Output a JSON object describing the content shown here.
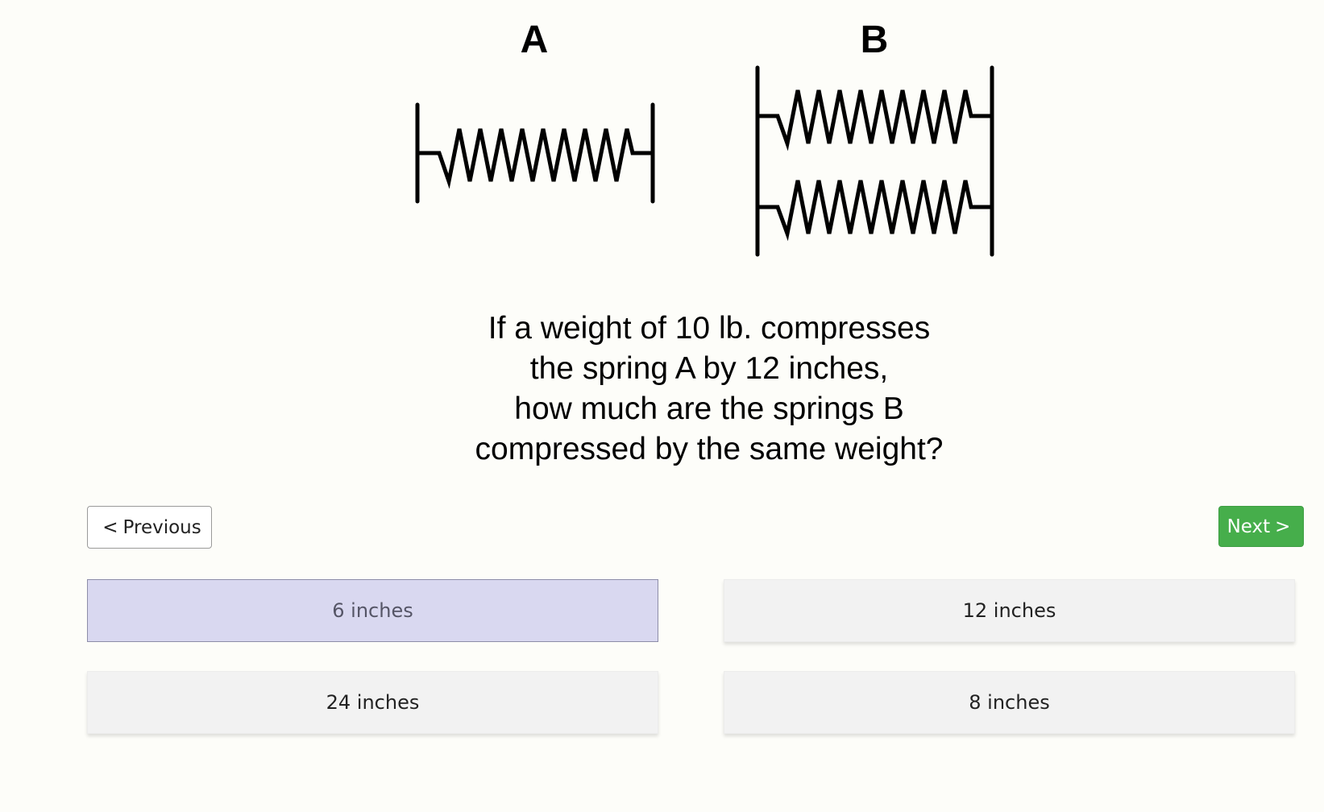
{
  "figure": {
    "label_a": "A",
    "label_b": "B",
    "question_lines": [
      "If a weight of 10 lb. compresses",
      "the spring A by 12 inches,",
      "how much are the springs B",
      "compressed by the same weight?"
    ]
  },
  "navigation": {
    "previous_label": "Previous",
    "next_label": "Next",
    "previous_chevron": "<",
    "next_chevron": ">",
    "next_color": "#46ae4b"
  },
  "options": [
    {
      "label": "6 inches",
      "selected": true
    },
    {
      "label": "12 inches",
      "selected": false
    },
    {
      "label": "24 inches",
      "selected": false
    },
    {
      "label": "8 inches",
      "selected": false
    }
  ],
  "colors": {
    "selected_option": "#d9d8f0",
    "option": "#f2f2f2",
    "background": "#fdfdf9"
  }
}
